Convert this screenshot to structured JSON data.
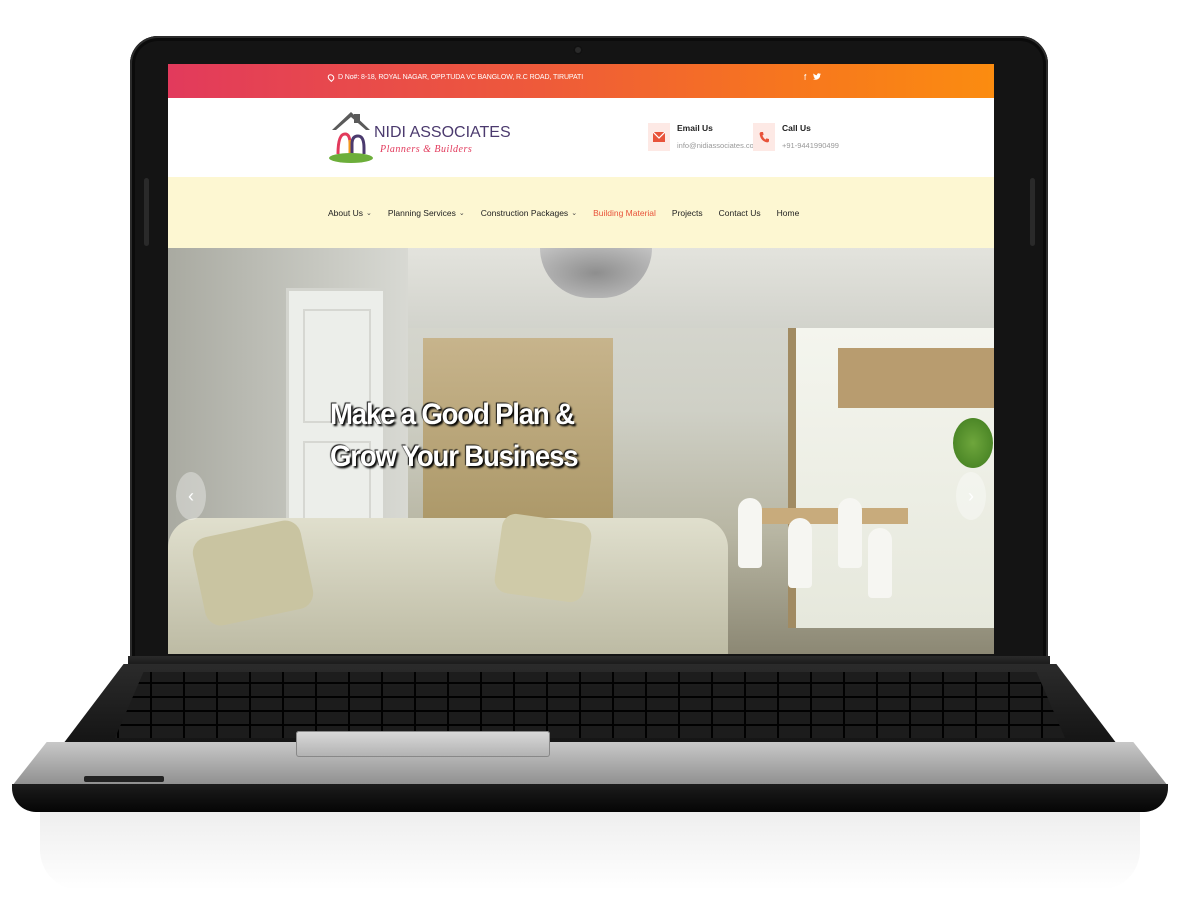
{
  "topbar": {
    "address": "D No#: 8-18, ROYAL NAGAR, OPP.TUDA VC BANGLOW, R.C ROAD, TIRUPATI",
    "social_facebook": "f",
    "social_twitter": "t"
  },
  "brand": {
    "name": "NIDI ASSOCIATES",
    "tagline": "Planners & Builders"
  },
  "contact": {
    "email_title": "Email Us",
    "email_value": "info@nidiassociates.com",
    "call_title": "Call Us",
    "call_value": "+91-9441990499"
  },
  "nav": {
    "items": [
      {
        "label": "About Us",
        "dropdown": true
      },
      {
        "label": "Planning Services",
        "dropdown": true
      },
      {
        "label": "Construction Packages",
        "dropdown": true
      },
      {
        "label": "Building Material",
        "active": true
      },
      {
        "label": "Projects"
      },
      {
        "label": "Contact Us"
      },
      {
        "label": "Home"
      }
    ],
    "active_color": "#e8533a"
  },
  "hero": {
    "line1": "Make a Good Plan &",
    "line2": "Grow Your Business",
    "prev_arrow": "‹",
    "next_arrow": "›"
  },
  "colors": {
    "topbar_start": "#e23a5c",
    "topbar_end": "#fb8c10",
    "nav_bg": "#fdf7d2"
  }
}
